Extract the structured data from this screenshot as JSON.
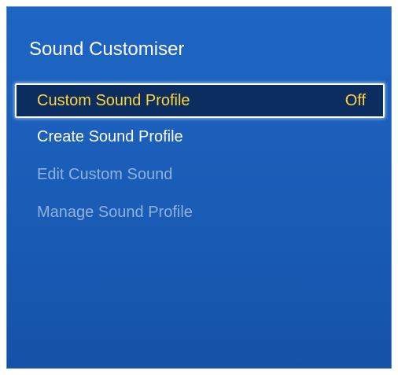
{
  "panel": {
    "title": "Sound Customiser"
  },
  "menu": {
    "items": [
      {
        "label": "Custom Sound Profile",
        "value": "Off",
        "state": "selected"
      },
      {
        "label": "Create Sound Profile",
        "state": "enabled"
      },
      {
        "label": "Edit Custom Sound",
        "state": "disabled"
      },
      {
        "label": "Manage Sound Profile",
        "state": "disabled"
      }
    ]
  },
  "colors": {
    "panel_background": "#1a5cb6",
    "selected_background": "#0c2d60",
    "selected_text": "#ffd43b",
    "enabled_text": "#ffffff",
    "disabled_text": "#8fb1de"
  }
}
